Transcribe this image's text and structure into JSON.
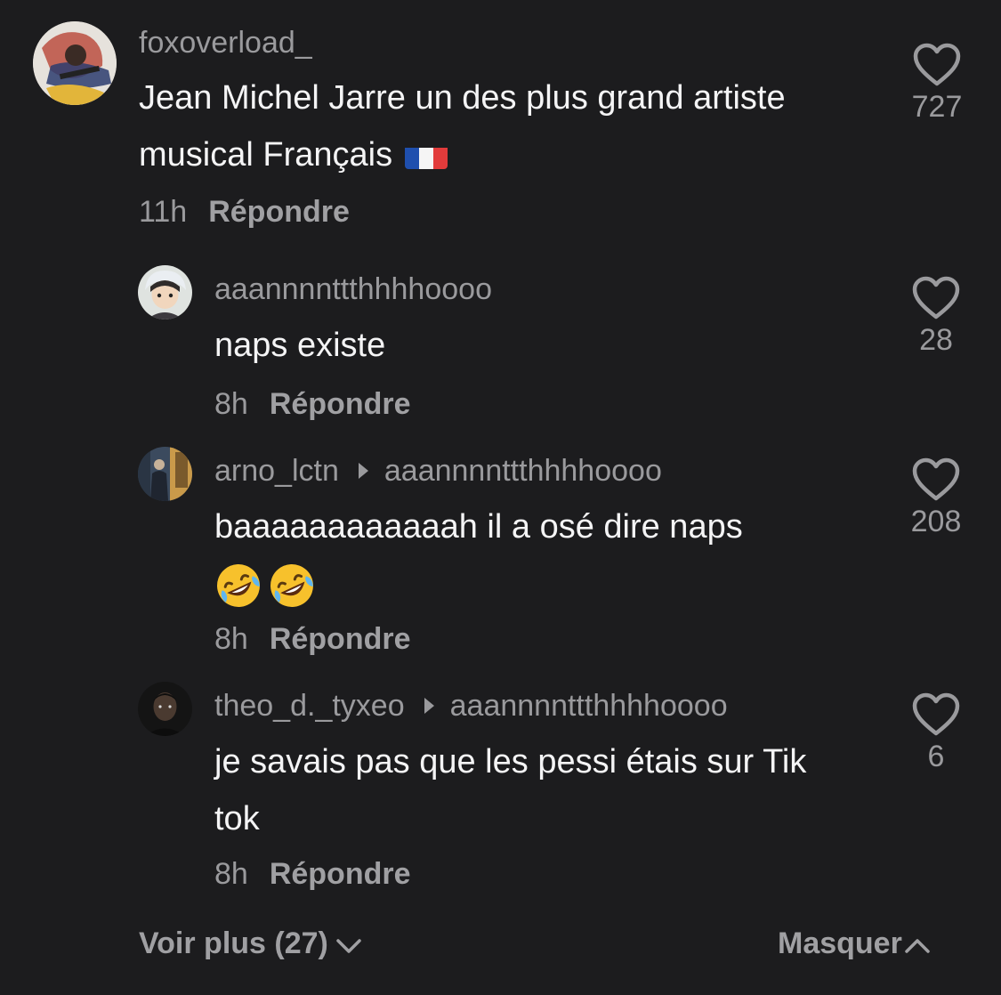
{
  "comments": [
    {
      "username": "foxoverload_",
      "reply_to": "",
      "text": "Jean Michel Jarre un des plus grand artiste musical Français",
      "time": "11h",
      "reply_label": "Répondre",
      "likes": "727",
      "avatar_icon": "avatar-painted-soldier",
      "trailing_icon": "france-flag-emoji"
    },
    {
      "username": "aaannnnttthhhhoooo",
      "reply_to": "",
      "text": "naps existe",
      "time": "8h",
      "reply_label": "Répondre",
      "likes": "28",
      "avatar_icon": "avatar-anime-character"
    },
    {
      "username": "arno_lctn",
      "reply_to": "aaannnnttthhhhoooo",
      "text": "baaaaaaaaaaaah il a osé dire naps",
      "time": "8h",
      "reply_label": "Répondre",
      "likes": "208",
      "avatar_icon": "avatar-hallway-photo",
      "trailing_icon": "rolling-laughing-emoji"
    },
    {
      "username": "theo_d._tyxeo",
      "reply_to": "aaannnnttthhhhoooo",
      "text": "je savais pas que les pessi étais sur Tik tok",
      "time": "8h",
      "reply_label": "Répondre",
      "likes": "6",
      "avatar_icon": "avatar-dark-portrait"
    }
  ],
  "footer": {
    "more_label": "Voir plus (27)",
    "hide_label": "Masquer"
  },
  "colors": {
    "background": "#1c1c1e",
    "text": "#f4f4f5",
    "muted": "#9a9a9d"
  }
}
